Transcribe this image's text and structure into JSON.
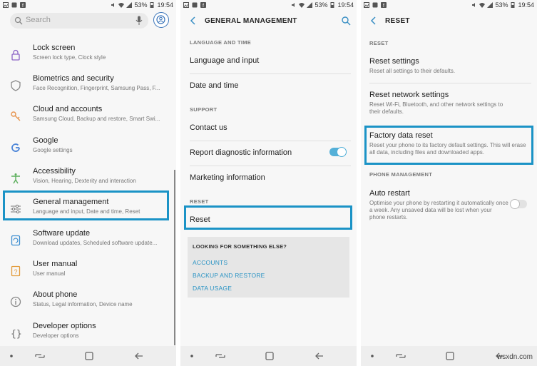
{
  "status": {
    "battery": "53%",
    "time": "19:54"
  },
  "colors": {
    "highlight": "#1b93c6",
    "accent": "#2a93c4",
    "toggle_on": "#54b0d8"
  },
  "panel1": {
    "search_placeholder": "Search",
    "items": [
      {
        "title": "Lock screen",
        "subtitle": "Screen lock type, Clock style",
        "icon": "lock-icon"
      },
      {
        "title": "Biometrics and security",
        "subtitle": "Face Recognition, Fingerprint, Samsung Pass, F...",
        "icon": "shield-icon"
      },
      {
        "title": "Cloud and accounts",
        "subtitle": "Samsung Cloud, Backup and restore, Smart Swi...",
        "icon": "key-icon"
      },
      {
        "title": "Google",
        "subtitle": "Google settings",
        "icon": "google-icon"
      },
      {
        "title": "Accessibility",
        "subtitle": "Vision, Hearing, Dexterity and interaction",
        "icon": "accessibility-icon"
      },
      {
        "title": "General management",
        "subtitle": "Language and input, Date and time, Reset",
        "icon": "sliders-icon"
      },
      {
        "title": "Software update",
        "subtitle": "Download updates, Scheduled software update...",
        "icon": "update-icon"
      },
      {
        "title": "User manual",
        "subtitle": "User manual",
        "icon": "manual-icon"
      },
      {
        "title": "About phone",
        "subtitle": "Status, Legal information, Device name",
        "icon": "info-icon"
      },
      {
        "title": "Developer options",
        "subtitle": "Developer options",
        "icon": "braces-icon"
      }
    ]
  },
  "panel2": {
    "title": "GENERAL MANAGEMENT",
    "sec_language": "LANGUAGE AND TIME",
    "language_input": "Language and input",
    "date_time": "Date and time",
    "sec_support": "SUPPORT",
    "contact_us": "Contact us",
    "report_diag": "Report diagnostic information",
    "report_diag_on": true,
    "marketing": "Marketing information",
    "sec_reset": "RESET",
    "reset": "Reset",
    "looking_title": "LOOKING FOR SOMETHING ELSE?",
    "links": [
      "ACCOUNTS",
      "BACKUP AND RESTORE",
      "DATA USAGE"
    ]
  },
  "panel3": {
    "title": "RESET",
    "sec_reset": "RESET",
    "reset_settings": "Reset settings",
    "reset_settings_sub": "Reset all settings to their defaults.",
    "reset_network": "Reset network settings",
    "reset_network_sub": "Reset Wi-Fi, Bluetooth, and other network settings to their defaults.",
    "factory": "Factory data reset",
    "factory_sub": "Reset your phone to its factory default settings. This will erase all data, including files and downloaded apps.",
    "sec_phone": "PHONE MANAGEMENT",
    "auto_restart": "Auto restart",
    "auto_restart_sub": "Optimise your phone by restarting it automatically once a week. Any unsaved data will be lost when your phone restarts.",
    "auto_restart_on": false
  },
  "watermark": "wsxdn.com"
}
